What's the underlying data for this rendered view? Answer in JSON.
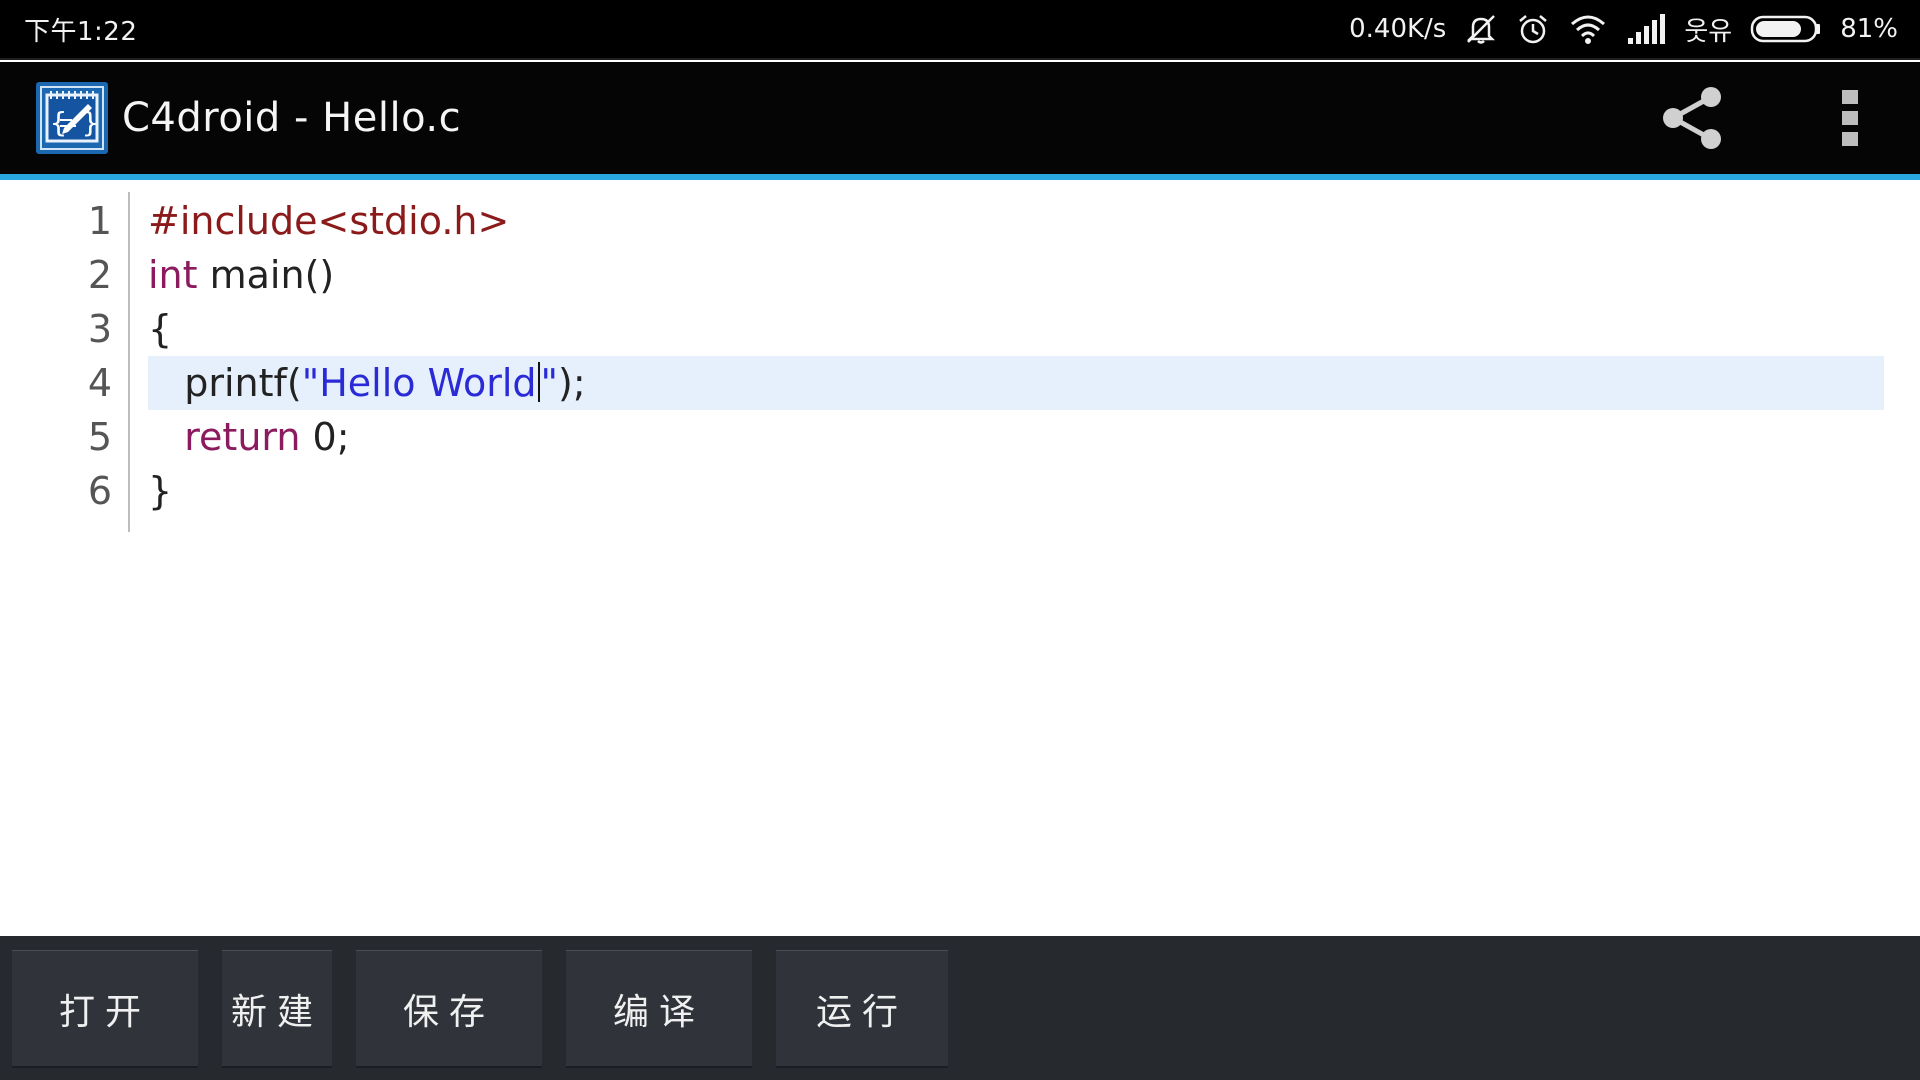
{
  "status_bar": {
    "time": "下午1:22",
    "network_speed": "0.40K/s",
    "carrier": "웃유",
    "battery_percent": "81%",
    "battery_level": 0.81,
    "icons": [
      "mute-icon",
      "alarm-icon",
      "wifi-icon",
      "signal-icon",
      "battery-icon"
    ]
  },
  "action_bar": {
    "title": "C4droid - Hello.c",
    "icons": [
      "app-logo-icon",
      "share-icon",
      "overflow-menu-icon"
    ],
    "accent_color": "#29a7e1"
  },
  "editor": {
    "lines": [
      {
        "num": "1",
        "indent": "",
        "tokens": [
          {
            "t": "#include<stdio.h>",
            "c": "pre"
          }
        ]
      },
      {
        "num": "2",
        "indent": "",
        "tokens": [
          {
            "t": "int",
            "c": "kw"
          },
          {
            "t": " main()",
            "c": "plain"
          }
        ]
      },
      {
        "num": "3",
        "indent": "",
        "tokens": [
          {
            "t": "{",
            "c": "plain"
          }
        ]
      },
      {
        "num": "4",
        "indent": "   ",
        "tokens": [
          {
            "t": "printf(",
            "c": "plain"
          },
          {
            "t": "\"Hello World",
            "c": "str"
          },
          {
            "t": "|",
            "c": "caret"
          },
          {
            "t": "\"",
            "c": "str"
          },
          {
            "t": ");",
            "c": "plain"
          }
        ]
      },
      {
        "num": "5",
        "indent": "   ",
        "tokens": [
          {
            "t": "return",
            "c": "kw"
          },
          {
            "t": " 0;",
            "c": "plain"
          }
        ]
      },
      {
        "num": "6",
        "indent": "",
        "tokens": [
          {
            "t": "}",
            "c": "plain"
          }
        ]
      }
    ],
    "highlighted_line": "4",
    "colors": {
      "preprocessor": "#8b1a1a",
      "keyword": "#8b1a5e",
      "string": "#2a2ad6",
      "highlight": "#e5f0fc"
    }
  },
  "bottom_bar": {
    "buttons": [
      {
        "name": "open",
        "label": "打开"
      },
      {
        "name": "new",
        "label": "新建"
      },
      {
        "name": "save",
        "label": "保存"
      },
      {
        "name": "compile",
        "label": "编译"
      },
      {
        "name": "run",
        "label": "运行"
      }
    ]
  }
}
